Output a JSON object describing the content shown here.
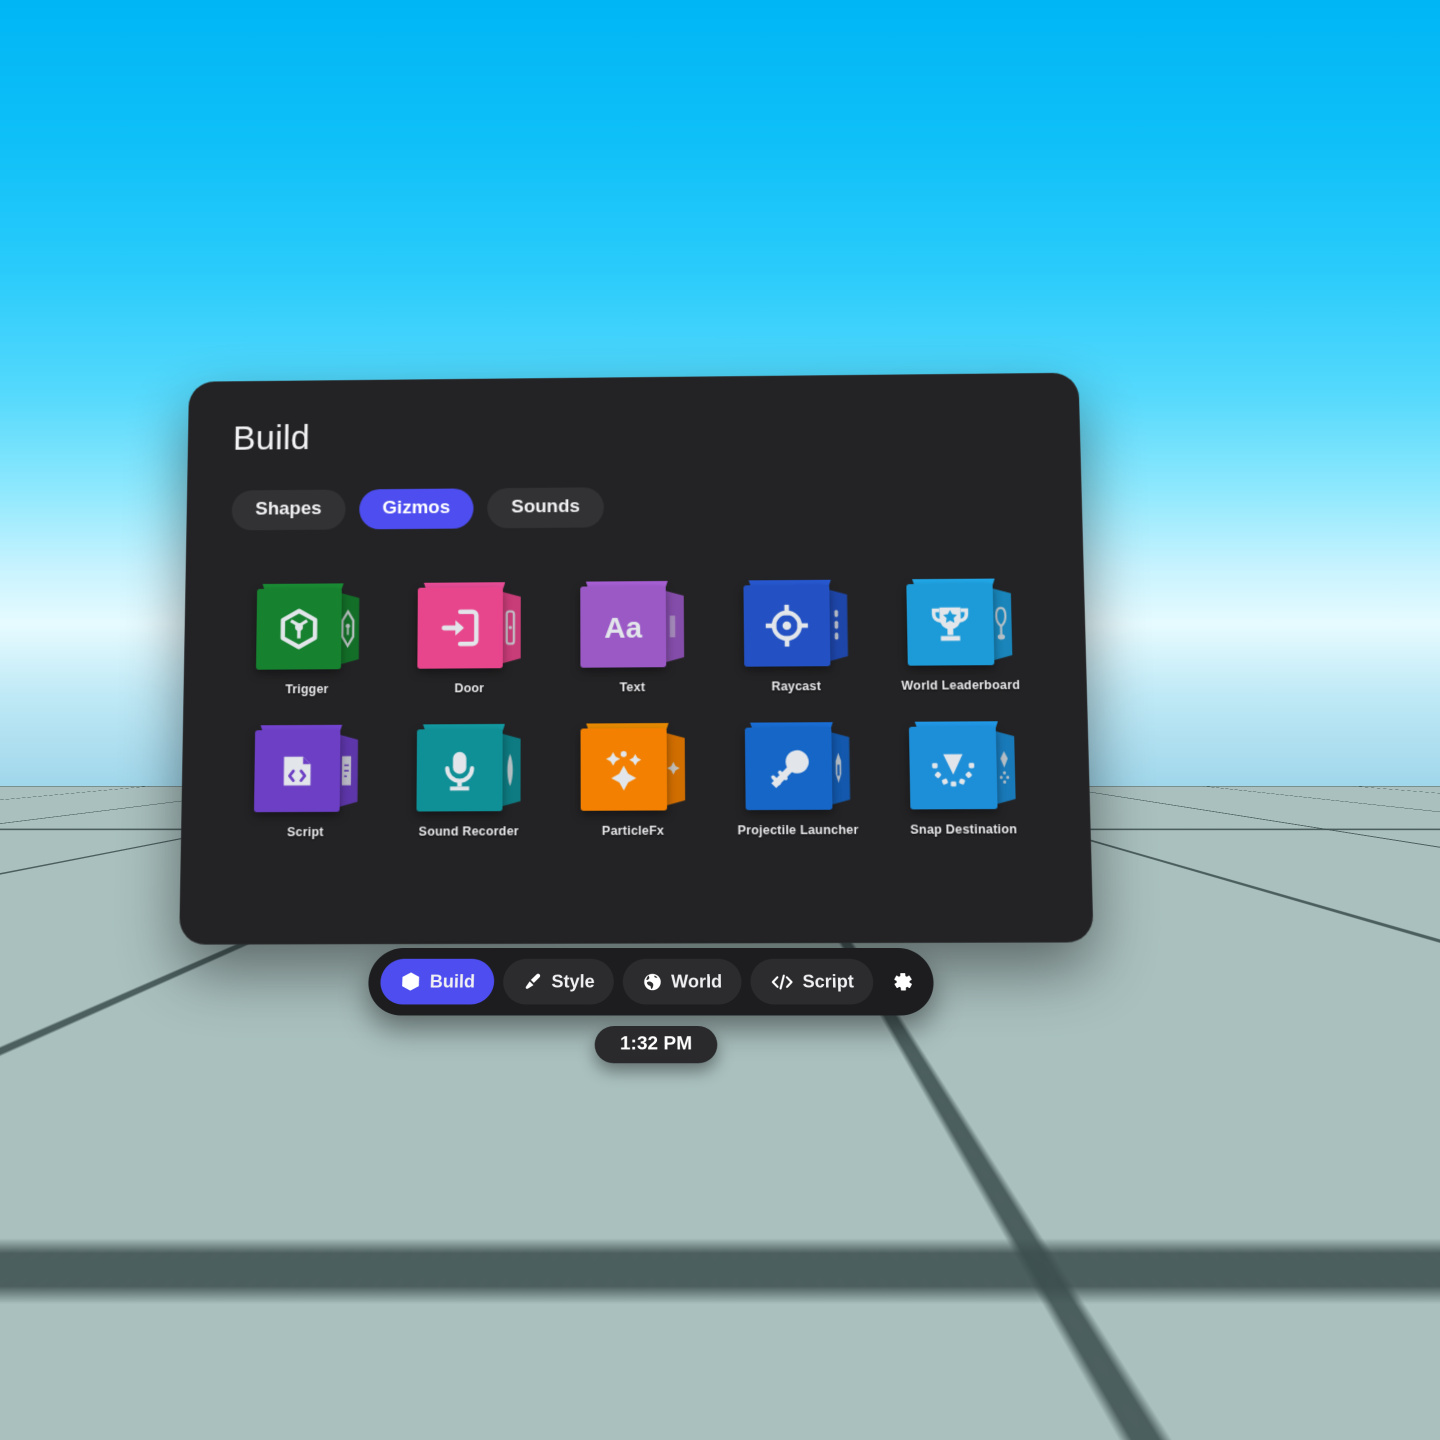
{
  "panel": {
    "title": "Build",
    "tabs": [
      {
        "label": "Shapes",
        "active": false
      },
      {
        "label": "Gizmos",
        "active": true
      },
      {
        "label": "Sounds",
        "active": false
      }
    ],
    "gizmos": [
      {
        "label": "Trigger",
        "icon": "trigger-hexagon-icon",
        "color": "#16812f",
        "side_icon": "trigger-side-icon"
      },
      {
        "label": "Door",
        "icon": "door-enter-icon",
        "color": "#e8468c",
        "side_icon": "door-side-icon"
      },
      {
        "label": "Text",
        "icon": "text-aa-icon",
        "color": "#9b59c6",
        "side_icon": "text-side-icon"
      },
      {
        "label": "Raycast",
        "icon": "raycast-target-icon",
        "color": "#2351c4",
        "side_icon": "raycast-side-icon"
      },
      {
        "label": "World Leaderboard",
        "icon": "trophy-star-icon",
        "color": "#1d9bd8",
        "side_icon": "leaderboard-side-icon"
      },
      {
        "label": "Script",
        "icon": "script-code-icon",
        "color": "#6c3fc4",
        "side_icon": "script-side-icon"
      },
      {
        "label": "Sound Recorder",
        "icon": "microphone-icon",
        "color": "#0f8f96",
        "side_icon": "mic-side-icon"
      },
      {
        "label": "ParticleFx",
        "icon": "sparkle-icon",
        "color": "#f38000",
        "side_icon": "sparkle-side-icon"
      },
      {
        "label": "Projectile Launcher",
        "icon": "wrench-launcher-icon",
        "color": "#1666c8",
        "side_icon": "launcher-side-icon"
      },
      {
        "label": "Snap Destination",
        "icon": "snap-arrow-down-icon",
        "color": "#1d8ed8",
        "side_icon": "snap-side-icon"
      }
    ]
  },
  "toolbar": {
    "buttons": [
      {
        "label": "Build",
        "icon": "cube-3d-icon",
        "active": true
      },
      {
        "label": "Style",
        "icon": "paintbrush-icon",
        "active": false
      },
      {
        "label": "World",
        "icon": "globe-icon",
        "active": false
      },
      {
        "label": "Script",
        "icon": "code-brackets-icon",
        "active": false
      }
    ],
    "settings_icon": "gear-icon"
  },
  "clock": {
    "time": "1:32 PM"
  },
  "colors": {
    "accent": "#4d4df0",
    "panel_bg": "#232325",
    "tab_bg": "#323234",
    "toolbar_bg": "#1d1d1f",
    "sky_top": "#00b6f5",
    "ground": "#a9c0be"
  }
}
